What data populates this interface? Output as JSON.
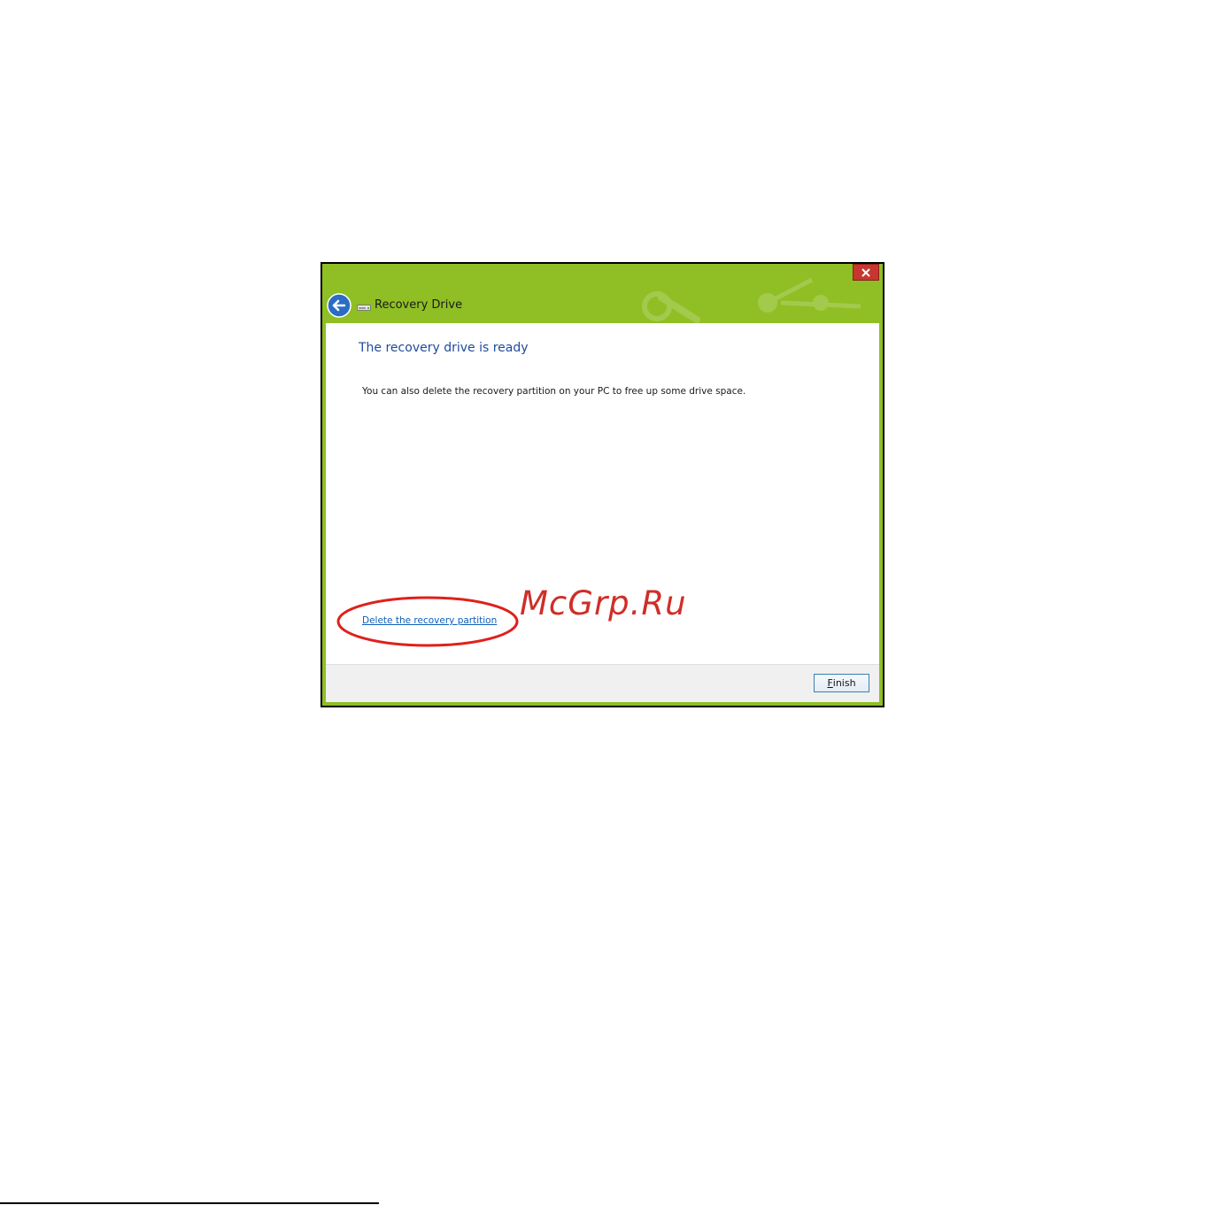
{
  "window": {
    "title": "Recovery Drive",
    "close_glyph": "✕"
  },
  "content": {
    "heading": "The recovery drive is ready",
    "body": "You can also delete the recovery partition on your PC to free up some drive space.",
    "delete_link": "Delete the recovery partition"
  },
  "footer": {
    "finish_mnemonic": "F",
    "finish_rest": "inish"
  },
  "annotation": {
    "watermark": "McGrp.Ru"
  },
  "icons": {
    "back": "back-arrow-icon",
    "drive": "usb-drive-icon",
    "close": "close-icon"
  },
  "colors": {
    "titlebar": "#8fbf24",
    "heading": "#1e4b9c",
    "link": "#0f5fb8",
    "highlight": "#e0201b",
    "close": "#c7372f"
  }
}
